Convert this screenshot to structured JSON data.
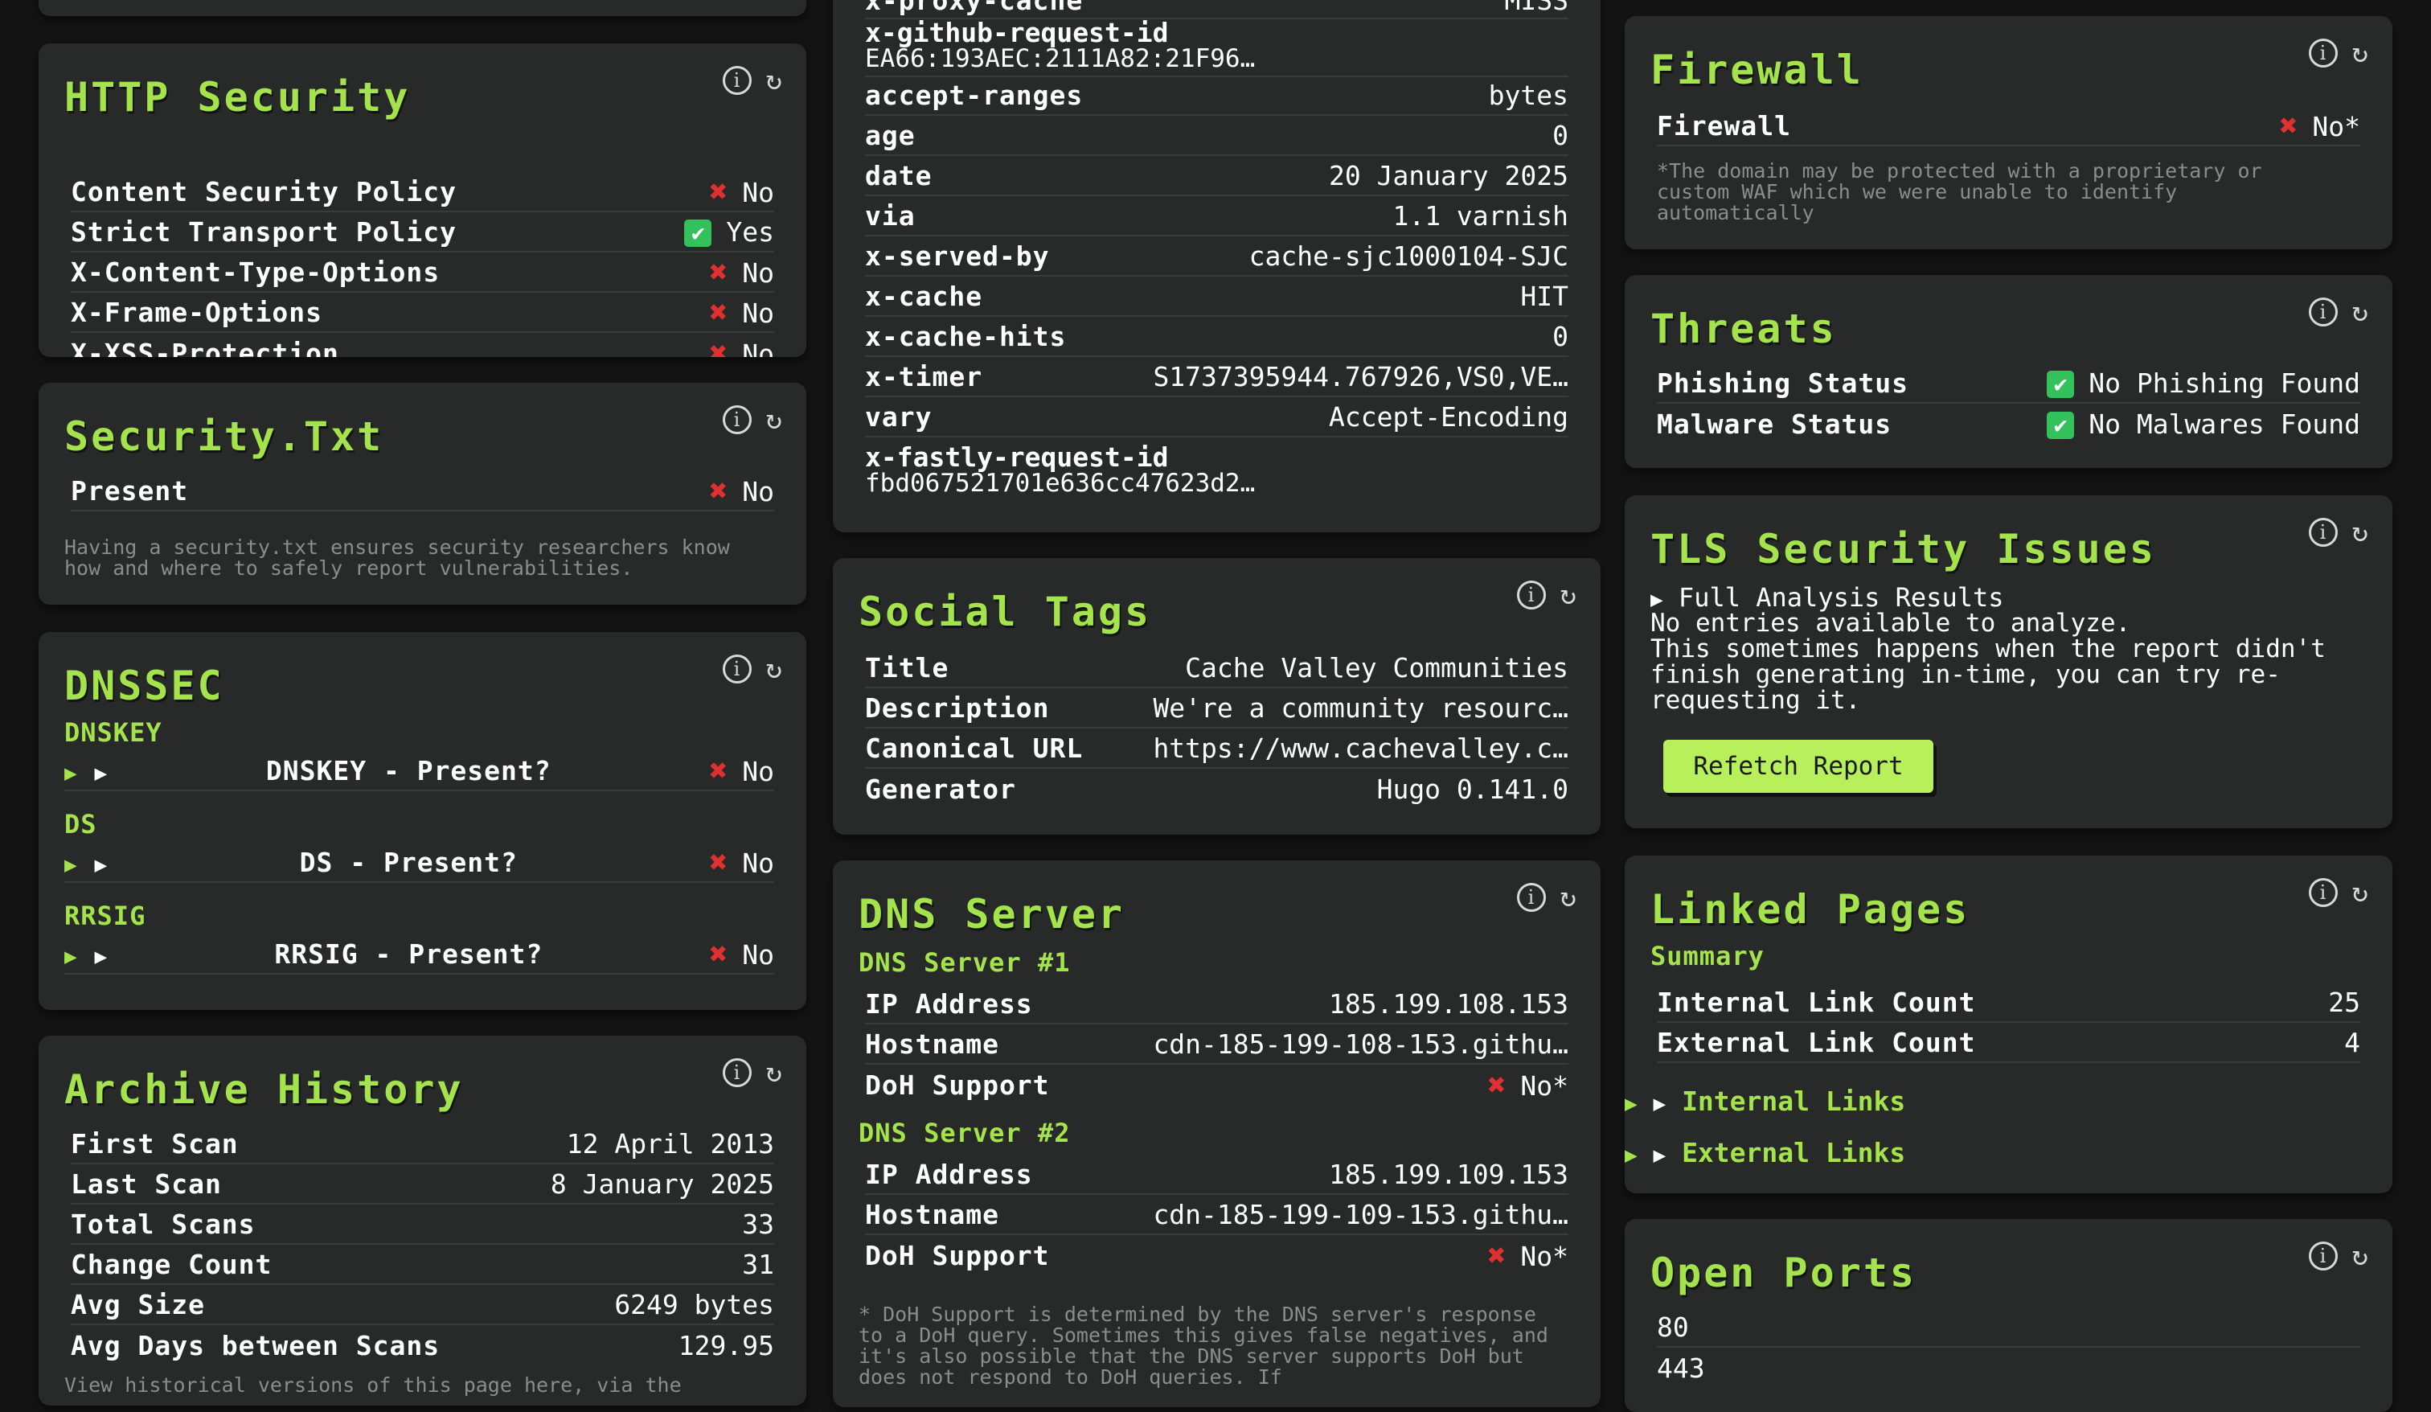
{
  "controls": {
    "info": "i",
    "refresh": "↻"
  },
  "http_security": {
    "title": "HTTP Security",
    "rows": [
      {
        "label": "Content Security Policy",
        "value": "No",
        "status": "fail"
      },
      {
        "label": "Strict Transport Policy",
        "value": "Yes",
        "status": "pass"
      },
      {
        "label": "X-Content-Type-Options",
        "value": "No",
        "status": "fail"
      },
      {
        "label": "X-Frame-Options",
        "value": "No",
        "status": "fail"
      },
      {
        "label": "X-XSS-Protection",
        "value": "No",
        "status": "fail"
      }
    ]
  },
  "security_txt": {
    "title": "Security.Txt",
    "present_label": "Present",
    "present_value": "No",
    "note": "Having a security.txt ensures security researchers know how and where to safely report vulnerabilities."
  },
  "dnssec": {
    "title": "DNSSEC",
    "sections": [
      {
        "heading": "DNSKEY",
        "label": "DNSKEY - Present?",
        "value": "No"
      },
      {
        "heading": "DS",
        "label": "DS - Present?",
        "value": "No"
      },
      {
        "heading": "RRSIG",
        "label": "RRSIG - Present?",
        "value": "No"
      }
    ]
  },
  "archive_history": {
    "title": "Archive History",
    "rows": [
      {
        "label": "First Scan",
        "value": "12 April 2013"
      },
      {
        "label": "Last Scan",
        "value": "8 January 2025"
      },
      {
        "label": "Total Scans",
        "value": "33"
      },
      {
        "label": "Change Count",
        "value": "31"
      },
      {
        "label": "Avg Size",
        "value": "6249 bytes"
      },
      {
        "label": "Avg Days between Scans",
        "value": "129.95"
      }
    ],
    "footer": "View historical versions of this page here, via the"
  },
  "headers": {
    "top_label": "x-proxy-cache",
    "top_value": "MISS",
    "request_id_label": "x-github-request-id",
    "request_id_value": "EA66:193AEC:2111A82:21F96…",
    "rows": [
      {
        "label": "accept-ranges",
        "value": "bytes"
      },
      {
        "label": "age",
        "value": "0"
      },
      {
        "label": "date",
        "value": "20 January 2025"
      },
      {
        "label": "via",
        "value": "1.1 varnish"
      },
      {
        "label": "x-served-by",
        "value": "cache-sjc1000104-SJC"
      },
      {
        "label": "x-cache",
        "value": "HIT"
      },
      {
        "label": "x-cache-hits",
        "value": "0"
      },
      {
        "label": "x-timer",
        "value": "S1737395944.767926,VS0,VE…"
      },
      {
        "label": "vary",
        "value": "Accept-Encoding"
      }
    ],
    "fastly_label": "x-fastly-request-id",
    "fastly_value": "fbd067521701e636cc47623d2…"
  },
  "social_tags": {
    "title": "Social Tags",
    "rows": [
      {
        "label": "Title",
        "value": "Cache Valley Communities"
      },
      {
        "label": "Description",
        "value": "We're a community resourc…"
      },
      {
        "label": "Canonical URL",
        "value": "https://www.cachevalley.c…"
      },
      {
        "label": "Generator",
        "value": "Hugo 0.141.0"
      }
    ]
  },
  "dns_server": {
    "title": "DNS Server",
    "servers": [
      {
        "heading": "DNS Server #1",
        "ip_label": "IP Address",
        "ip": "185.199.108.153",
        "host_label": "Hostname",
        "host": "cdn-185-199-108-153.githu…",
        "doh_label": "DoH Support",
        "doh": "No*"
      },
      {
        "heading": "DNS Server #2",
        "ip_label": "IP Address",
        "ip": "185.199.109.153",
        "host_label": "Hostname",
        "host": "cdn-185-199-109-153.githu…",
        "doh_label": "DoH Support",
        "doh": "No*"
      }
    ],
    "note": "* DoH Support is determined by the DNS server's response to a DoH query. Sometimes this gives false negatives, and it's also possible that the DNS server supports DoH but does not respond to DoH queries. If"
  },
  "firewall": {
    "title": "Firewall",
    "label": "Firewall",
    "value": "No*",
    "note": "*The domain may be protected with a proprietary or custom WAF which we were unable to identify automatically"
  },
  "threats": {
    "title": "Threats",
    "rows": [
      {
        "label": "Phishing Status",
        "value": "No Phishing Found"
      },
      {
        "label": "Malware Status",
        "value": "No Malwares Found"
      }
    ]
  },
  "tls": {
    "title": "TLS Security Issues",
    "summary": "Full Analysis Results",
    "line1": "No entries available to analyze.",
    "line2": "This sometimes happens when the report didn't finish generating in-time, you can try re-requesting it.",
    "button": "Refetch Report"
  },
  "linked_pages": {
    "title": "Linked Pages",
    "summary": "Summary",
    "rows": [
      {
        "label": "Internal Link Count",
        "value": "25"
      },
      {
        "label": "External Link Count",
        "value": "4"
      }
    ],
    "internal": "Internal Links",
    "external": "External Links"
  },
  "open_ports": {
    "title": "Open Ports",
    "ports": [
      "80",
      "443"
    ]
  },
  "colors": {
    "accent": "#a4e34c",
    "card": "#282a2a",
    "background": "#141414",
    "fail": "#e0302f",
    "pass": "#33c15b"
  }
}
